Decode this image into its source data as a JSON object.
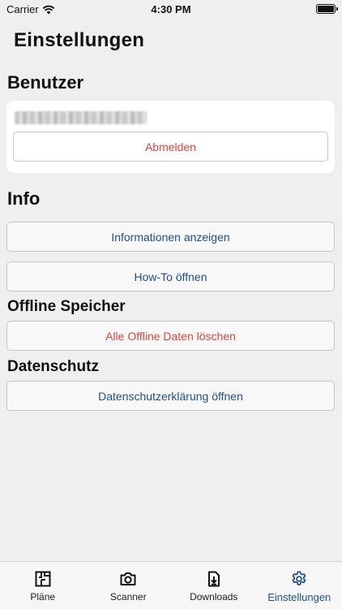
{
  "status_bar": {
    "carrier": "Carrier",
    "time": "4:30 PM",
    "battery_level": 1.0
  },
  "page_title": "Einstellungen",
  "sections": {
    "user": {
      "title": "Benutzer",
      "logout_label": "Abmelden"
    },
    "info": {
      "title": "Info",
      "show_info_label": "Informationen anzeigen",
      "howto_label": "How-To öffnen"
    },
    "offline": {
      "title": "Offline Speicher",
      "delete_label": "Alle Offline Daten löschen"
    },
    "privacy": {
      "title": "Datenschutz",
      "privacy_label": "Datenschutzerklärung öffnen"
    }
  },
  "tabbar": {
    "items": [
      {
        "label": "Pläne",
        "icon": "floorplan-icon",
        "active": false
      },
      {
        "label": "Scanner",
        "icon": "camera-icon",
        "active": false
      },
      {
        "label": "Downloads",
        "icon": "download-icon",
        "active": false
      },
      {
        "label": "Einstellungen",
        "icon": "gear-icon",
        "active": true
      }
    ]
  },
  "colors": {
    "accent": "#1e4f8c",
    "danger": "#e0443e",
    "background": "#efefef"
  }
}
